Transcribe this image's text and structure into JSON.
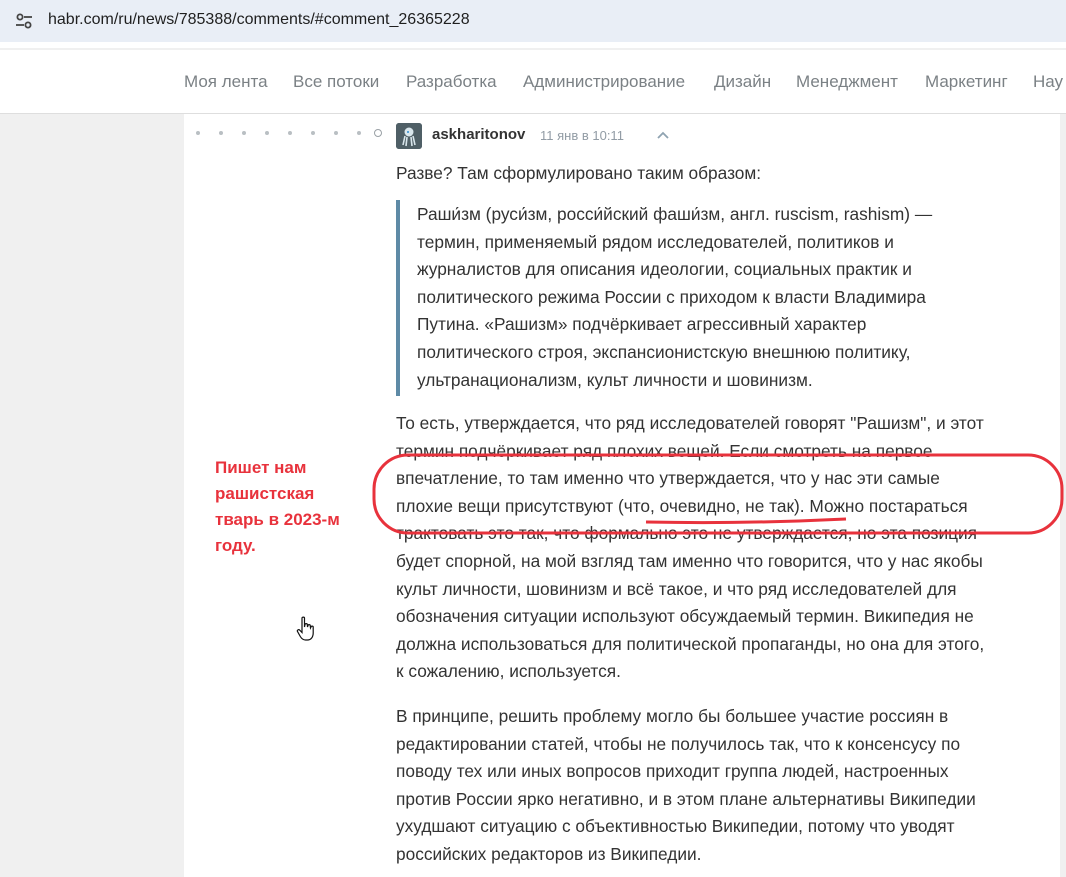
{
  "browser": {
    "url": "habr.com/ru/news/785388/comments/#comment_26365228"
  },
  "nav": {
    "items": [
      "Моя лента",
      "Все потоки",
      "Разработка",
      "Администрирование",
      "Дизайн",
      "Менеджмент",
      "Маркетинг",
      "Нау"
    ]
  },
  "comment": {
    "author": "askharitonov",
    "time": "11 янв в 10:11",
    "intro": "Разве? Там сформулировано таким образом:",
    "quote_lines": [
      "Раши́зм (руси́зм, росси́йский фаши́зм, англ. ruscism, rashism) —",
      "термин, применяемый рядом исследователей, политиков и",
      "журналистов для описания идеологии, социальных практик и",
      "политического режима России с приходом к власти Владимира",
      "Путина. «Рашизм» подчёркивает агрессивный характер",
      "политического строя, экспансионистскую внешнюю политику,",
      "ультранационализм, культ личности и шовинизм."
    ],
    "para2_lines": [
      "То есть, утверждается, что ряд исследователей говорят \"Рашизм\", и этот",
      "термин подчёркивает ряд плохих вещей. Если смотреть на первое",
      "впечатление, то там именно что утверждается, что у нас эти самые",
      "плохие вещи присутствуют (что, очевидно, не так). Можно постараться",
      "трактовать это так, что формально это не утверждается, но эта позиция",
      "будет спорной, на мой взгляд там именно что говорится, что у нас якобы",
      "культ личности, шовинизм и всё такое, и что ряд исследователей для",
      "обозначения ситуации используют обсуждаемый термин. Википедия не",
      "должна использоваться для политической пропаганды, но она для этого,",
      "к сожалению, используется."
    ],
    "para3_lines": [
      "В принципе, решить проблему могло бы большее участие россиян в",
      "редактировании статей, чтобы не получилось так, что к консенсусу по",
      "поводу тех или иных вопросов приходит группа людей, настроенных",
      "против России ярко негативно, и в этом плане альтернативы Википедии",
      "ухудшают ситуацию с объективностью Википедии, потому что уводят",
      "российских редакторов из Википедии."
    ]
  },
  "annotation": {
    "lines": [
      "Пишет нам",
      "рашистская",
      "тварь в 2023-м",
      "году."
    ],
    "color": "#e8323c"
  },
  "icons": {
    "site_info": "tune-icon",
    "collapse": "chevron-up-icon",
    "cursor": "hand-pointer-icon"
  }
}
